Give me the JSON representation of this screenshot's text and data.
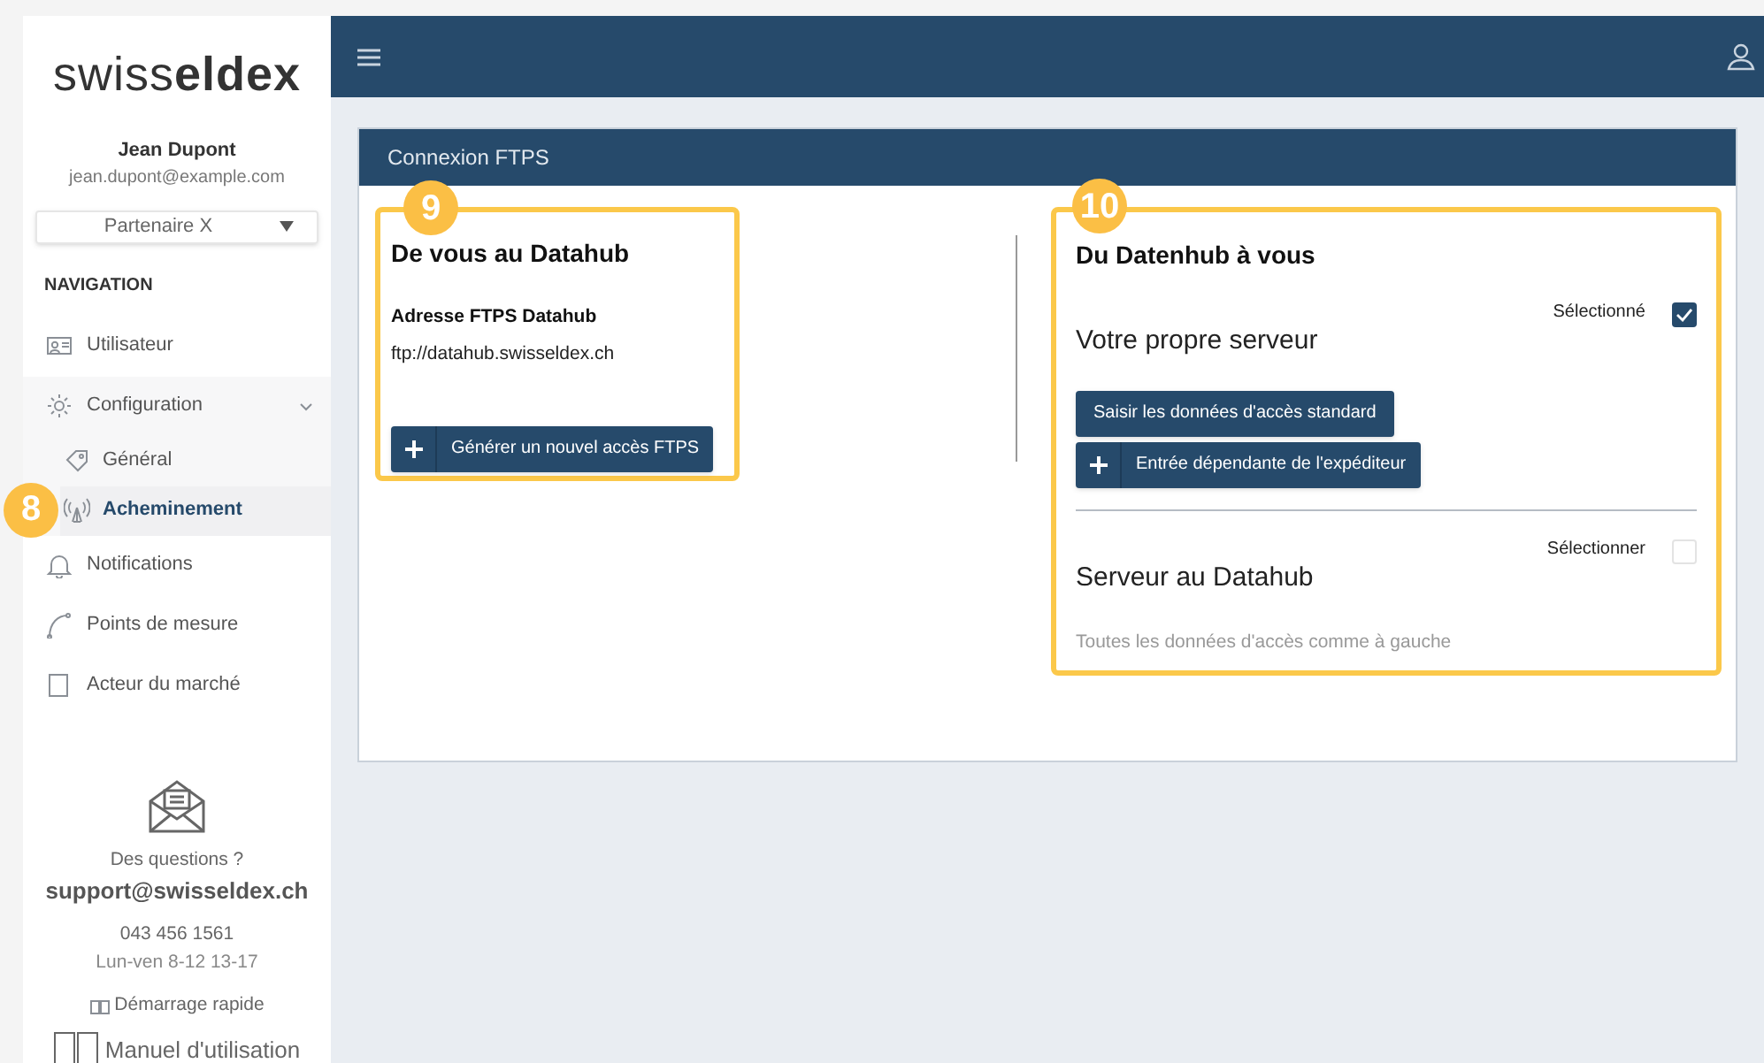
{
  "logo": "swiss**eldex**",
  "user": {
    "name": "Jean Dupont",
    "email": "jean.dupont@example.com"
  },
  "partner_select": {
    "value": "Partenaire X"
  },
  "nav_heading": "NAVIGATION",
  "nav": [
    {
      "label": "Utilisateur",
      "selected": false
    },
    {
      "label": "Configuration",
      "selected": false,
      "expanded": true,
      "children": [
        {
          "label": "Général",
          "selected": false
        },
        {
          "label": "Acheminement",
          "selected": true,
          "callout": "8"
        }
      ]
    },
    {
      "label": "Notifications",
      "selected": false
    },
    {
      "label": "Points de mesure",
      "selected": false
    },
    {
      "label": "Acteur du marché",
      "selected": false
    }
  ],
  "support": {
    "question": "Des questions ?",
    "email": "support@swisseldex.ch",
    "phone": "043 456 1561",
    "hours": "Lun-ven 8-12 13-17",
    "quick_start": "Démarrage rapide",
    "manual": "Manuel d'utilisation"
  },
  "panel": {
    "title": "Connexion FTPS",
    "left": {
      "callout": "9",
      "heading": "De vous au Datahub",
      "field_label": "Adresse FTPS Datahub",
      "field_value": "ftp://datahub.swisseldex.ch",
      "button": "Générer un nouvel accès FTPS"
    },
    "right": {
      "callout": "10",
      "heading": "Du Datenhub à vous",
      "options": [
        {
          "title": "Votre propre serveur",
          "checkbox_label": "Sélectionné",
          "checked": true,
          "buttons": [
            {
              "label": "Saisir les données d'accès standard",
              "kind": "plain"
            },
            {
              "label": "Entrée dépendante de l'expéditeur",
              "kind": "add"
            }
          ]
        },
        {
          "title": "Serveur au Datahub",
          "checkbox_label": "Sélectionner",
          "checked": false,
          "note": "Toutes les données d'accès comme à gauche"
        }
      ]
    }
  }
}
